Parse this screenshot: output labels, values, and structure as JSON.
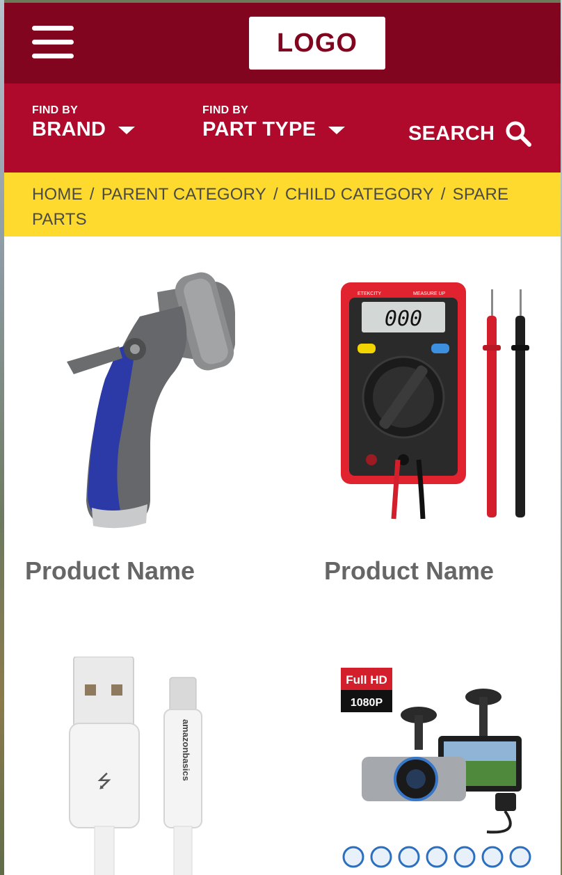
{
  "header": {
    "logo_text": "LOGO",
    "menu_icon": "hamburger-menu-icon"
  },
  "nav": {
    "brand": {
      "small": "FIND BY",
      "label": "BRAND"
    },
    "part_type": {
      "small": "FIND BY",
      "label": "PART TYPE"
    },
    "search": {
      "label": "SEARCH",
      "icon": "search-icon"
    }
  },
  "breadcrumb": {
    "items": [
      "HOME",
      "PARENT CATEGORY",
      "CHILD CATEGORY",
      "SPARE PARTS"
    ],
    "separator": "/"
  },
  "products": [
    {
      "name": "Product Name",
      "image": "hose-spray-nozzle"
    },
    {
      "name": "Product Name",
      "image": "digital-multimeter"
    },
    {
      "name": "",
      "image": "usb-lightning-cable"
    },
    {
      "name": "",
      "image": "dash-camera"
    }
  ],
  "dashcam_badge": {
    "line1": "Full HD",
    "line2": "1080P"
  },
  "multimeter": {
    "display": "000",
    "brand": "ETEKCITY",
    "model_line": "MEASURE UP"
  },
  "cable_brand": "amazonbasics",
  "colors": {
    "topbar": "#82051f",
    "navbar": "#af0a2b",
    "breadcrumb_bg": "#fdda2d",
    "product_text": "#666666"
  }
}
